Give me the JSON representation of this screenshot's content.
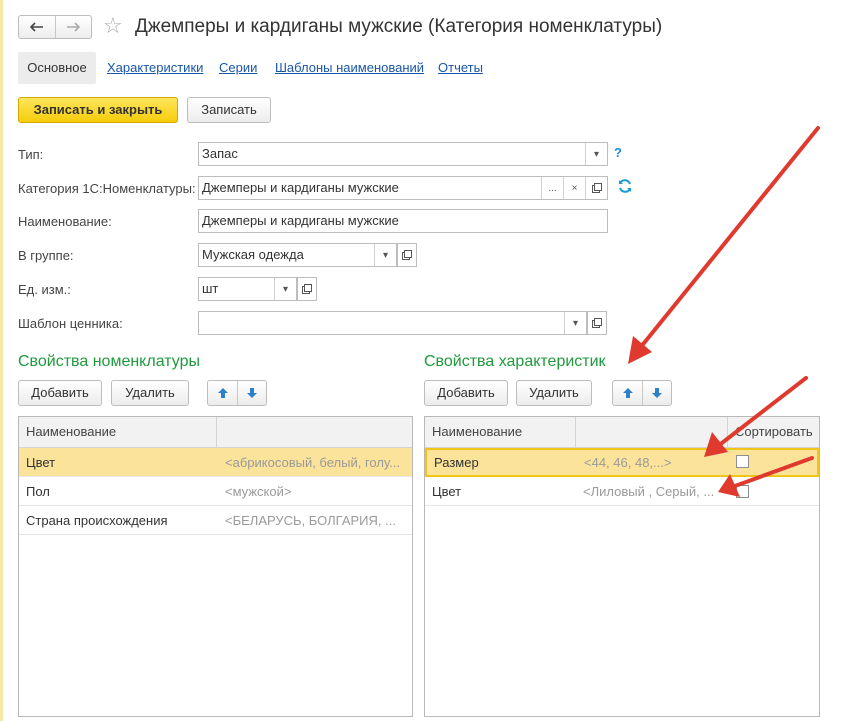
{
  "header": {
    "title": "Джемперы и кардиганы мужские (Категория номенклатуры)",
    "back_icon": "arrow-left-icon",
    "forward_icon": "arrow-right-icon",
    "favorite_icon": "star-icon"
  },
  "tabs": [
    {
      "label": "Основное",
      "active": true
    },
    {
      "label": "Характеристики",
      "active": false
    },
    {
      "label": "Серии",
      "active": false
    },
    {
      "label": "Шаблоны наименований",
      "active": false
    },
    {
      "label": "Отчеты",
      "active": false
    }
  ],
  "toolbar": {
    "save_close_label": "Записать и закрыть",
    "save_label": "Записать"
  },
  "form": {
    "type": {
      "label": "Тип:",
      "value": "Запас",
      "help": "?"
    },
    "category": {
      "label": "Категория 1С:Номенклатуры:",
      "value": "Джемперы и кардиганы мужские",
      "select_btn": "...",
      "clear_btn": "×"
    },
    "name": {
      "label": "Наименование:",
      "value": "Джемперы и кардиганы мужские"
    },
    "group": {
      "label": "В группе:",
      "value": "Мужская одежда"
    },
    "unit": {
      "label": "Ед. изм.:",
      "value": "шт"
    },
    "price_tag_template": {
      "label": "Шаблон ценника:",
      "value": ""
    }
  },
  "item_properties": {
    "title": "Свойства номенклатуры",
    "add_label": "Добавить",
    "delete_label": "Удалить",
    "columns": [
      "Наименование",
      ""
    ],
    "rows": [
      {
        "name": "Цвет",
        "values": "<абрикосовый, белый, голу...",
        "selected": true
      },
      {
        "name": "Пол",
        "values": "<мужской>",
        "selected": false
      },
      {
        "name": "Страна происхождения",
        "values": "<БЕЛАРУСЬ, БОЛГАРИЯ, ...",
        "selected": false
      }
    ]
  },
  "characteristic_properties": {
    "title": "Свойства характеристик",
    "add_label": "Добавить",
    "delete_label": "Удалить",
    "columns": [
      "Наименование",
      "",
      "Сортировать"
    ],
    "rows": [
      {
        "name": "Размер",
        "values": "<44, 46, 48,...>",
        "sort": false,
        "selected": true
      },
      {
        "name": "Цвет",
        "values": "<Лиловый , Серый, ...",
        "sort": false,
        "selected": false
      }
    ]
  },
  "colors": {
    "accent_yellow": "#f5cc0a",
    "section_green": "#1f9a3c",
    "link_blue": "#1a56a8",
    "selected_row": "#fbe39a",
    "annotation_red": "#e03a2f"
  }
}
